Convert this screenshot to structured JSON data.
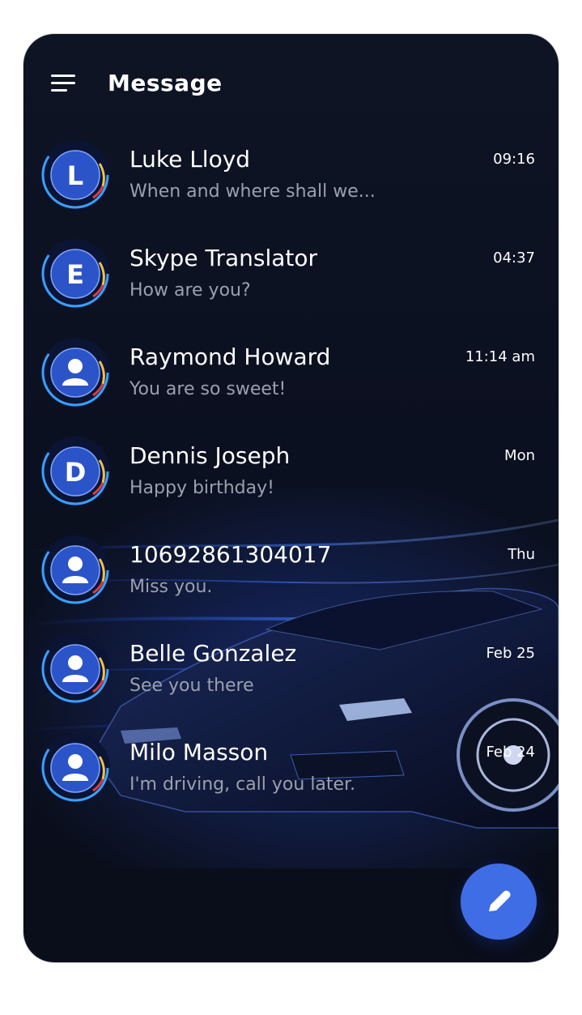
{
  "header": {
    "title": "Message",
    "menu_icon": "hamburger-menu-icon"
  },
  "conversations": [
    {
      "name": "Luke Lloyd",
      "preview": "When and where shall we...",
      "time": "09:16",
      "avatar": {
        "type": "letter",
        "letter": "L"
      }
    },
    {
      "name": "Skype Translator",
      "preview": "How are you?",
      "time": "04:37",
      "avatar": {
        "type": "letter",
        "letter": "E"
      }
    },
    {
      "name": "Raymond Howard",
      "preview": "You are so sweet!",
      "time": "11:14 am",
      "avatar": {
        "type": "person"
      }
    },
    {
      "name": "Dennis Joseph",
      "preview": "Happy birthday!",
      "time": "Mon",
      "avatar": {
        "type": "letter",
        "letter": "D"
      }
    },
    {
      "name": "10692861304017",
      "preview": "Miss you.",
      "time": "Thu",
      "avatar": {
        "type": "person"
      }
    },
    {
      "name": "Belle Gonzalez",
      "preview": "See you there",
      "time": "Feb 25",
      "avatar": {
        "type": "person"
      }
    },
    {
      "name": "Milo Masson",
      "preview": "I'm driving, call you later.",
      "time": "Feb 24",
      "avatar": {
        "type": "person"
      }
    }
  ],
  "fab": {
    "icon": "pencil-compose-icon"
  },
  "colors": {
    "background": "#0b1020",
    "accent": "#3f6de6",
    "avatar_fill": "#2c54c9",
    "gauge_red": "#e23b3b",
    "gauge_yellow": "#f2c14a",
    "gauge_blue": "#3aa0ff",
    "preview_text": "#9aa0ad"
  }
}
